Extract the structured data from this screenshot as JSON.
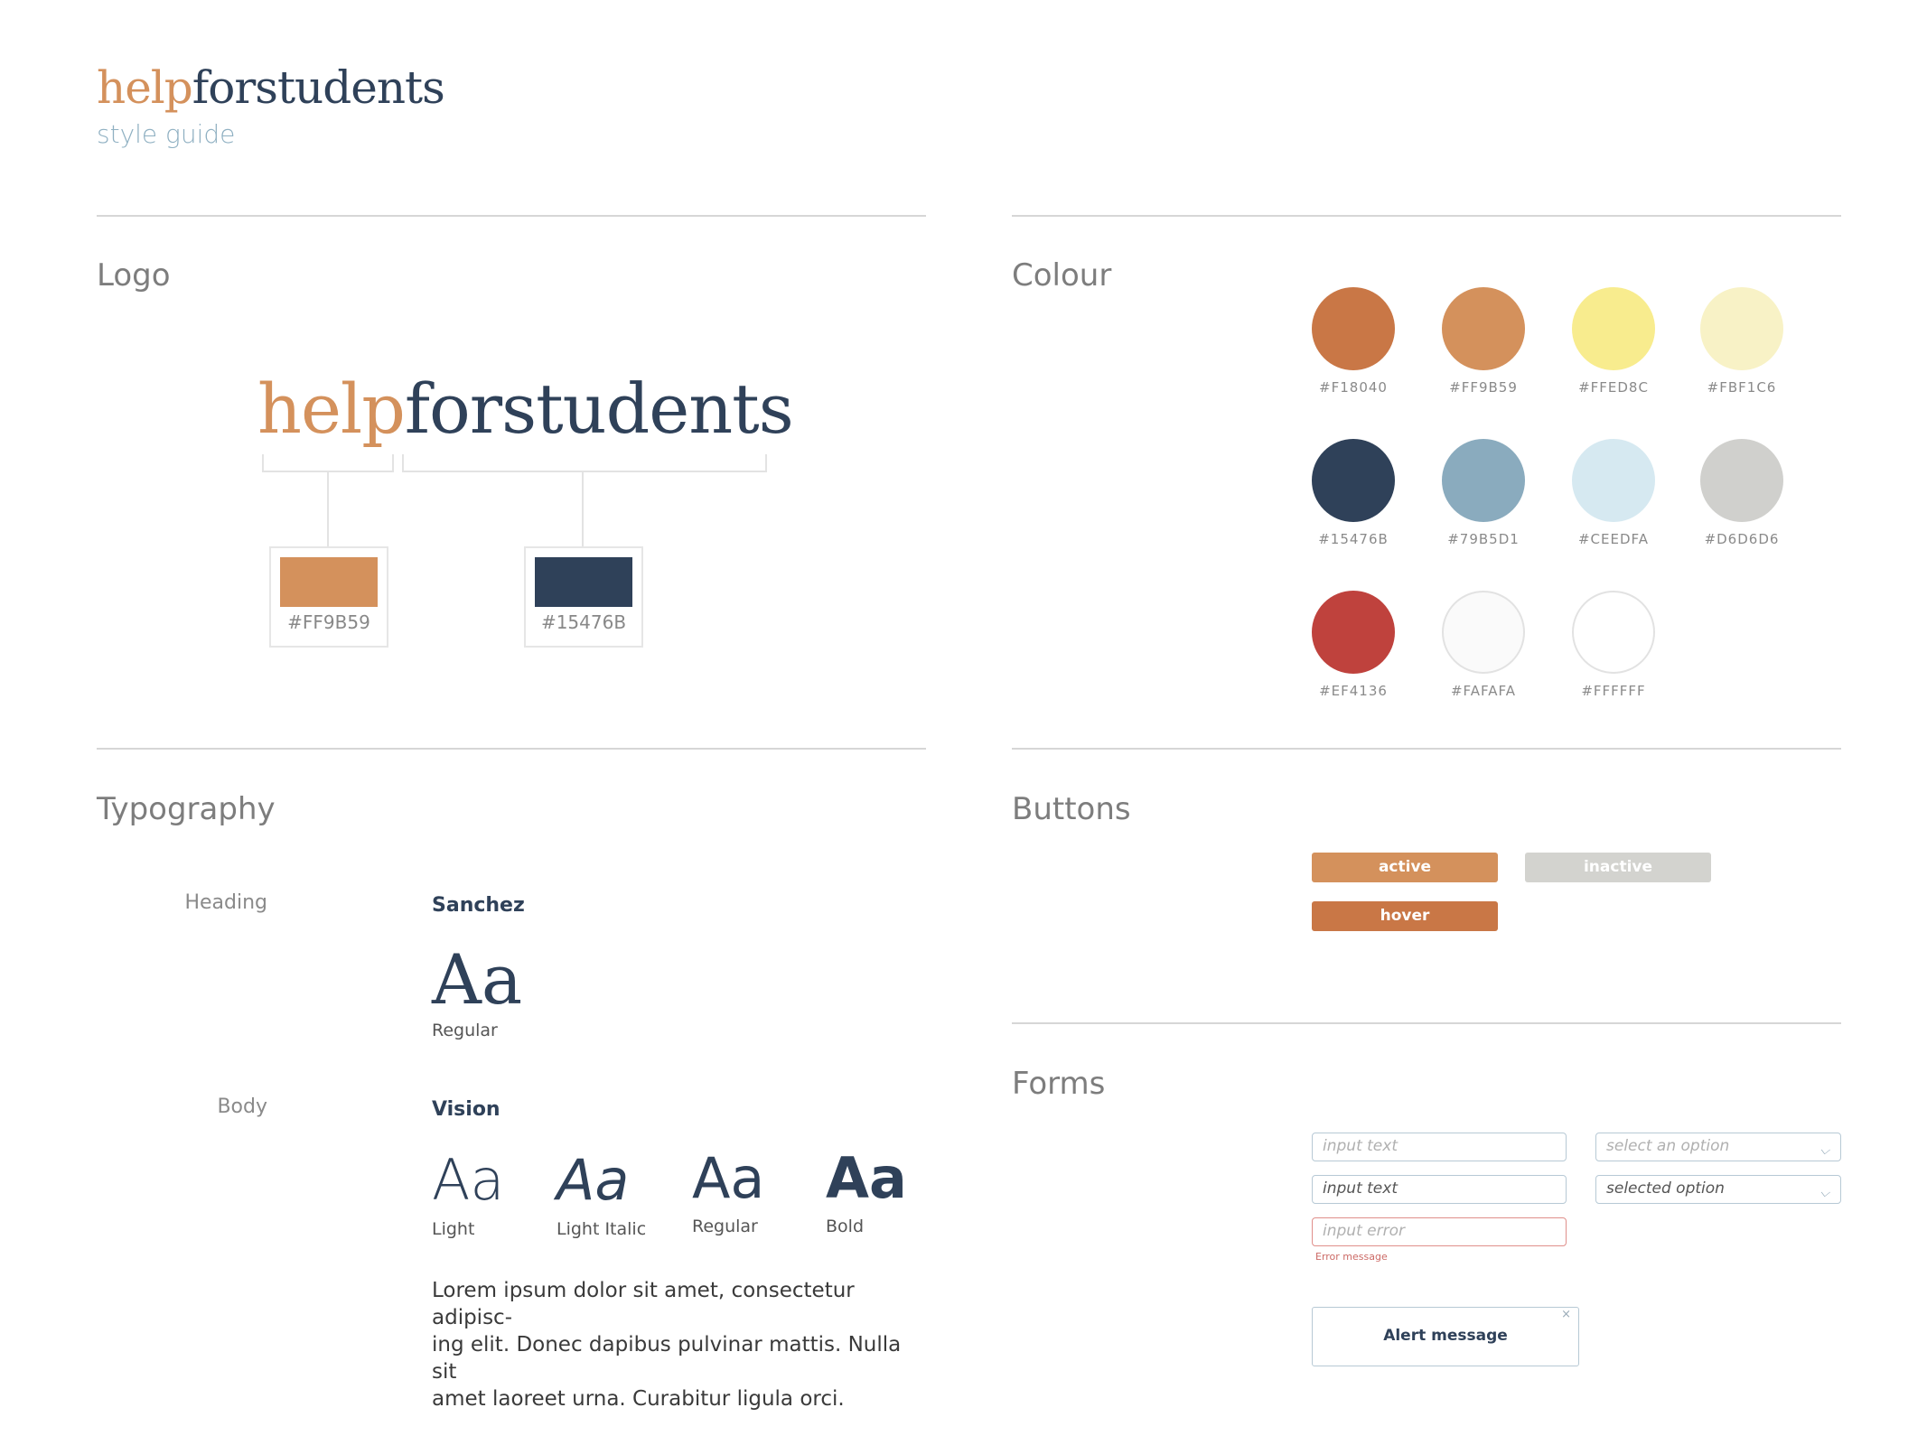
{
  "header": {
    "brand_part1": "help",
    "brand_part2": "forstudents",
    "subtitle": "style guide"
  },
  "sections": {
    "logo": "Logo",
    "colour": "Colour",
    "typography": "Typography",
    "buttons": "Buttons",
    "forms": "Forms"
  },
  "logo": {
    "brand_part1": "help",
    "brand_part2": "forstudents",
    "swatches": [
      {
        "hex": "#FF9B59",
        "color": "#d4915c"
      },
      {
        "hex": "#15476B",
        "color": "#2f4159"
      }
    ]
  },
  "colours": [
    {
      "hex": "#F18040",
      "color": "#c97746"
    },
    {
      "hex": "#FF9B59",
      "color": "#d4915c"
    },
    {
      "hex": "#FFED8C",
      "color": "#f8ec8e"
    },
    {
      "hex": "#FBF1C6",
      "color": "#f8f2c6"
    },
    {
      "hex": "#15476B",
      "color": "#2f4159"
    },
    {
      "hex": "#79B5D1",
      "color": "#8aabbe"
    },
    {
      "hex": "#CEEDFA",
      "color": "#d6e9f1"
    },
    {
      "hex": "#D6D6D6",
      "color": "#d0d0cd"
    },
    {
      "hex": "#EF4136",
      "color": "#bf423d"
    },
    {
      "hex": "#FAFAFA",
      "color": "#fafafa"
    },
    {
      "hex": "#FFFFFF",
      "color": "#ffffff"
    }
  ],
  "typography": {
    "heading": {
      "label": "Heading",
      "font": "Sanchez",
      "samples": [
        {
          "glyphs": "Aa",
          "weight": "Regular"
        }
      ]
    },
    "body": {
      "label": "Body",
      "font": "Vision",
      "samples": [
        {
          "glyphs": "Aa",
          "weight": "Light"
        },
        {
          "glyphs": "Aa",
          "weight": "Light Italic"
        },
        {
          "glyphs": "Aa",
          "weight": "Regular"
        },
        {
          "glyphs": "Aa",
          "weight": "Bold"
        }
      ],
      "lorem_lines": [
        "Lorem ipsum dolor sit amet, consectetur adipisc-",
        "ing elit. Donec dapibus pulvinar mattis. Nulla sit",
        "amet laoreet urna. Curabitur ligula orci."
      ]
    }
  },
  "buttons": {
    "active": {
      "label": "active",
      "color": "#d4915c"
    },
    "inactive": {
      "label": "inactive",
      "color": "#d3d3cf"
    },
    "hover": {
      "label": "hover",
      "color": "#c97746"
    }
  },
  "forms": {
    "input_empty_placeholder": "input text",
    "input_filled_value": "input text",
    "input_error_placeholder": "input error",
    "error_message": "Error message",
    "select_empty_placeholder": "select an option",
    "select_filled_value": "selected option",
    "alert_message": "Alert message",
    "alert_close": "×",
    "chevron": "⌄"
  }
}
